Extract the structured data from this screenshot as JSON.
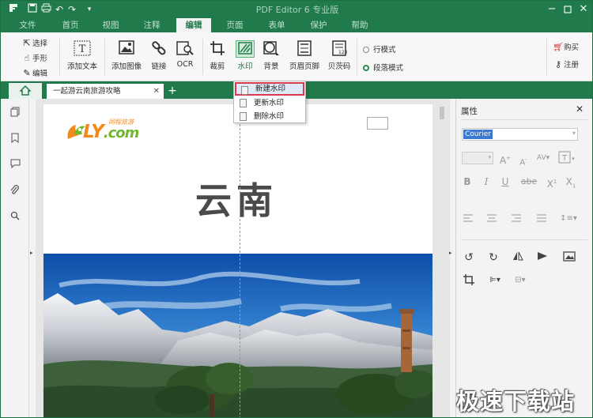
{
  "app": {
    "title": "PDF Editor 6 专业版"
  },
  "menu": {
    "items": [
      {
        "label": "文件"
      },
      {
        "label": "首页"
      },
      {
        "label": "视图"
      },
      {
        "label": "注释"
      },
      {
        "label": "编辑",
        "active": true
      },
      {
        "label": "页面"
      },
      {
        "label": "表单"
      },
      {
        "label": "保护"
      },
      {
        "label": "帮助"
      }
    ]
  },
  "ribbon": {
    "select": "选择",
    "hand": "手形",
    "edit": "编辑",
    "add_text": "添加文本",
    "add_image": "添加图像",
    "link": "链接",
    "ocr": "OCR",
    "crop": "裁剪",
    "watermark": "水印",
    "background": "背景",
    "header_footer": "页眉页脚",
    "bates": "贝茨码",
    "line_mode": "行模式",
    "paragraph_mode": "段落模式",
    "buy": "购买",
    "register": "注册"
  },
  "tabs": {
    "doc_title": "一起游云南旅游攻略"
  },
  "watermark_menu": {
    "items": [
      "新建水印",
      "更新水印",
      "删除水印"
    ]
  },
  "document": {
    "logo_text": "LY",
    "logo_suffix": ".com",
    "logo_cn": "同程旅游",
    "title": "云南"
  },
  "properties": {
    "title": "属性",
    "font": "Courier"
  },
  "overlay_watermark": "极速下载站",
  "colors": {
    "brand": "#217a4b",
    "selection": "#d93b4c"
  }
}
